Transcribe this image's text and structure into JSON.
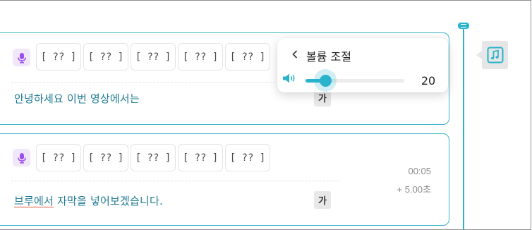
{
  "colors": {
    "accent": "#29b3cc",
    "mic_bg": "#f1e7fb",
    "mic_icon": "#9b4ff0",
    "text": "#1f7a92",
    "underline": "#e0533d"
  },
  "subtitles": [
    {
      "chips": [
        "[ ?? ]",
        "[ ?? ]",
        "[ ?? ]",
        "[ ?? ]",
        "[ ?? ]"
      ],
      "text": "안녕하세요 이번 영상에서는",
      "style_button": "가"
    },
    {
      "chips": [
        "[ ?? ]",
        "[ ?? ]",
        "[ ?? ]",
        "[ ?? ]",
        "[ ?? ]"
      ],
      "text_underlined": "브루에서",
      "text_rest": " 자막을 넣어보겠습니다.",
      "style_button": "가",
      "start_time": "00:05",
      "duration": "+ 5.00초"
    }
  ],
  "volume_popup": {
    "title": "볼륨 조절",
    "value": "20",
    "level_percent": 20,
    "back_icon": "chevron-left-icon",
    "speaker_icon": "speaker-icon"
  },
  "sidebar": {
    "music_icon": "music-note-icon"
  }
}
